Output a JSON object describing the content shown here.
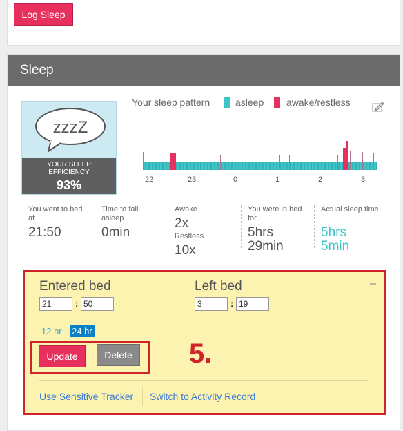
{
  "top": {
    "log_sleep_label": "Log Sleep"
  },
  "sleep": {
    "title": "Sleep",
    "efficiency": {
      "bubble_text": "zzzZ",
      "label_line1": "YOUR SLEEP",
      "label_line2": "EFFICIENCY",
      "value": "93%"
    },
    "pattern": {
      "title": "Your sleep pattern",
      "legend_asleep": "asleep",
      "legend_awake": "awake/restless",
      "colors": {
        "asleep": "#3ec5c9",
        "awake": "#e8305e",
        "restless": "#b07090"
      },
      "ticks": [
        "22",
        "23",
        "0",
        "1",
        "2",
        "3"
      ]
    },
    "stats": {
      "went_to_bed_label1": "You went to bed",
      "went_to_bed_label2": "at",
      "went_to_bed_value": "21:50",
      "time_to_fall_label1": "Time to fall",
      "time_to_fall_label2": "asleep",
      "time_to_fall_value": "0min",
      "awake_label": "Awake",
      "awake_value": "2x",
      "restless_label": "Restless",
      "restless_value": "10x",
      "in_bed_label1": "You were in bed",
      "in_bed_label2": "for",
      "in_bed_value1": "5hrs",
      "in_bed_value2": "29min",
      "actual_label": "Actual sleep time",
      "actual_value1": "5hrs",
      "actual_value2": "5min"
    },
    "edit": {
      "entered_label": "Entered bed",
      "entered_hour": "21",
      "entered_min": "50",
      "left_label": "Left bed",
      "left_hour": "3",
      "left_min": "19",
      "colon": ":",
      "mode_12": "12 hr",
      "mode_24": "24 hr",
      "update_label": "Update",
      "delete_label": "Delete",
      "step": "5.",
      "link_sensitive": "Use Sensitive Tracker",
      "link_switch": "Switch to Activity Record",
      "collapse": "–"
    }
  }
}
